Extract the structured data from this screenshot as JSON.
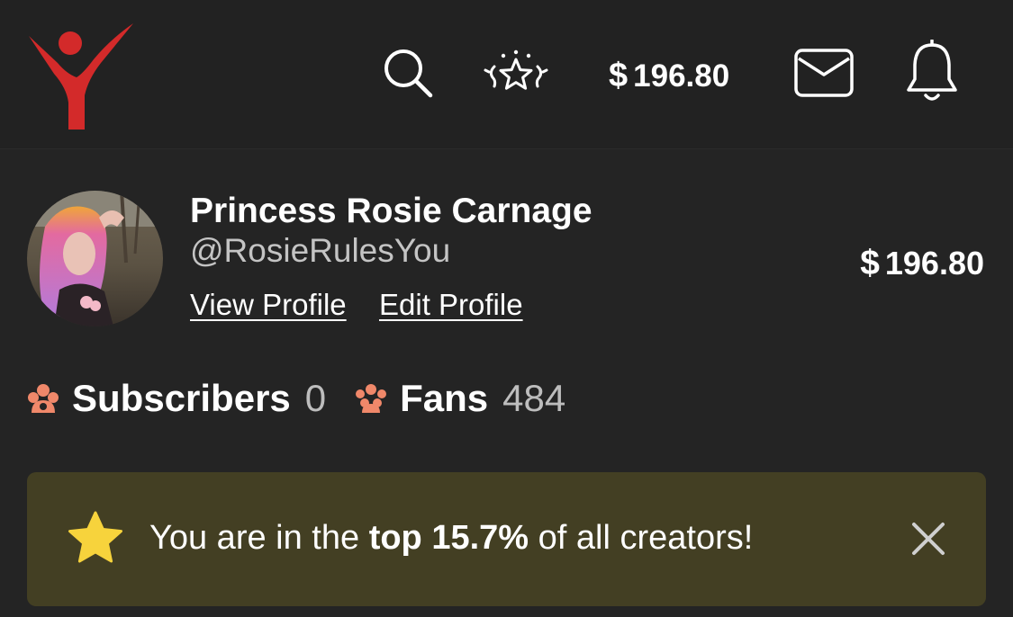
{
  "header": {
    "balance_currency": "$",
    "balance_amount": "196.80",
    "icons": [
      "brand-logo",
      "search-icon",
      "creators-star-icon",
      "mail-icon",
      "bell-icon"
    ]
  },
  "profile": {
    "name": "Princess Rosie Carnage",
    "handle": "@RosieRulesYou",
    "view_profile_label": "View Profile",
    "edit_profile_label": "Edit Profile",
    "balance_currency": "$",
    "balance_amount": "196.80"
  },
  "stats": {
    "subscribers_label": "Subscribers",
    "subscribers_value": "0",
    "fans_label": "Fans",
    "fans_value": "484"
  },
  "banner": {
    "text_before": "You are in the ",
    "text_bold": "top 15.7%",
    "text_after": " of all creators!"
  },
  "colors": {
    "background": "#242424",
    "header_background": "#222222",
    "brand_red": "#d32a2a",
    "accent_orange": "#f0886a",
    "banner_background": "#433f23",
    "star_yellow": "#f7d33c"
  }
}
